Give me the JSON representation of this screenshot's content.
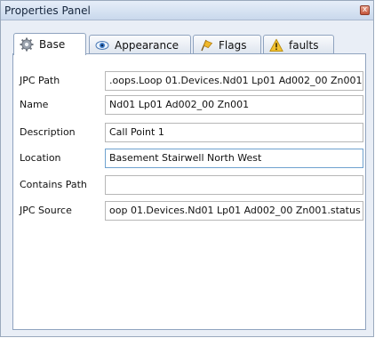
{
  "window": {
    "title": "Properties Panel",
    "close_glyph": "x"
  },
  "tabs": [
    {
      "label": "Base",
      "icon": "gear-icon",
      "active": true
    },
    {
      "label": "Appearance",
      "icon": "eye-icon",
      "active": false
    },
    {
      "label": "Flags",
      "icon": "flag-icon",
      "active": false
    },
    {
      "label": "faults",
      "icon": "warning-icon",
      "active": false
    }
  ],
  "properties": [
    {
      "label": "JPC Path",
      "value": ".oops.Loop 01.Devices.Nd01 Lp01 Ad002_00 Zn001"
    },
    {
      "label": "Name",
      "value": "Nd01 Lp01 Ad002_00 Zn001"
    },
    {
      "label": "Description",
      "value": "Call Point 1"
    },
    {
      "label": "Location",
      "value": "Basement Stairwell North West"
    },
    {
      "label": "Contains Path",
      "value": ""
    },
    {
      "label": "JPC Source",
      "value": "oop 01.Devices.Nd01 Lp01 Ad002_00 Zn001.status"
    }
  ],
  "colors": {
    "accent": "#6fa2cf",
    "warning": "#f2c12e",
    "close": "#c4553b"
  }
}
